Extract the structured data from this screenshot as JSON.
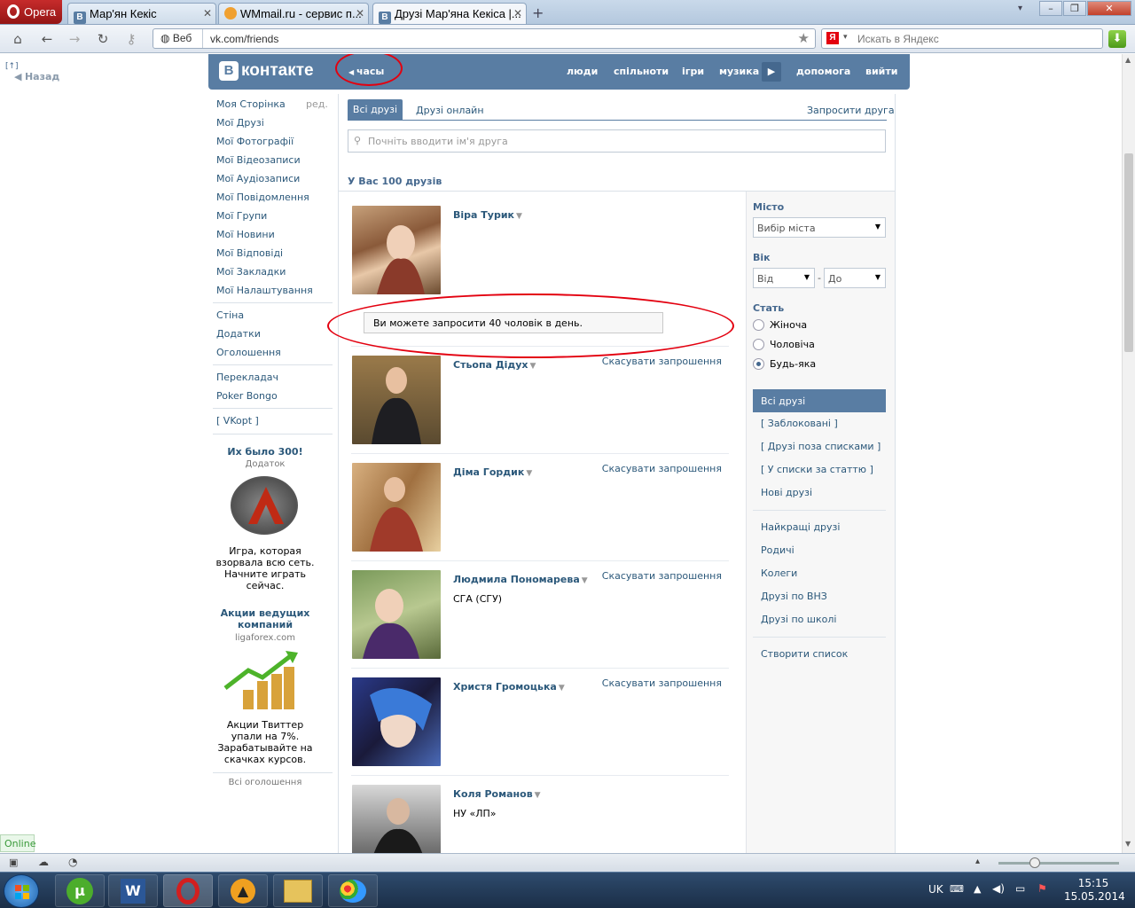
{
  "browser": {
    "opera_label": "Opera",
    "tabs": [
      {
        "title": "Мар'ян Кекіс",
        "fav": "В"
      },
      {
        "title": "WMmail.ru - сервис п...",
        "fav": ""
      },
      {
        "title": "Друзі Мар'яна Кекіса |...",
        "fav": "В"
      }
    ],
    "web_badge": "Веб",
    "url": "vk.com/friends",
    "search_placeholder": "Искать в Яндекс"
  },
  "page": {
    "back_label": "Назад"
  },
  "header": {
    "logo": "контакте",
    "logo_badge": "В",
    "clock_label": "часы",
    "nav": [
      "люди",
      "спільноти",
      "ігри",
      "музика",
      "допомога",
      "вийти"
    ]
  },
  "left_menu": {
    "edit_label": "ред.",
    "items": [
      "Моя Сторінка",
      "Мої Друзі",
      "Мої Фотографії",
      "Мої Відеозаписи",
      "Мої Аудіозаписи",
      "Мої Повідомлення",
      "Мої Групи",
      "Мої Новини",
      "Мої Відповіді",
      "Мої Закладки",
      "Мої Налаштування"
    ],
    "group2": [
      "Стіна",
      "Додатки",
      "Оголошення"
    ],
    "group3": [
      "Перекладач",
      "Poker Bongo"
    ],
    "vkopt": "[ VKopt ]",
    "ad1": {
      "title": "Их было 300!",
      "sub": "Додаток",
      "text": "Игра, которая взорвала всю сеть. Начните играть сейчас."
    },
    "ad2": {
      "title": "Акции ведущих компаний",
      "sub": "ligaforex.com",
      "text": "Акции Твиттер упали на 7%. Зарабатывайте на скачках курсов."
    },
    "all_ads": "Всі оголошення"
  },
  "main": {
    "tab_all": "Всі друзі",
    "tab_online": "Друзі онлайн",
    "invite": "Запросити друга",
    "search_placeholder": "Почніть вводити ім'я друга",
    "count": "У Вас 100 друзів",
    "tooltip": "Ви можете запросити 40 чоловік в день.",
    "friends": [
      {
        "name": "Віра Турик",
        "sub": "",
        "cancel": ""
      },
      {
        "name": "Стьопа Дідух",
        "sub": "",
        "cancel": "Скасувати запрошення"
      },
      {
        "name": "Діма Гордик",
        "sub": "",
        "cancel": "Скасувати запрошення"
      },
      {
        "name": "Людмила Пономарева",
        "sub": "СГА (СГУ)",
        "cancel": "Скасувати запрошення"
      },
      {
        "name": "Христя Громоцька",
        "sub": "",
        "cancel": "Скасувати запрошення"
      },
      {
        "name": "Коля Романов",
        "sub": "НУ «ЛП»",
        "cancel": ""
      }
    ]
  },
  "filter": {
    "city_label": "Місто",
    "city_value": "Вибір міста",
    "age_label": "Вік",
    "age_from": "Від",
    "age_to": "До",
    "gender_label": "Стать",
    "genders": [
      "Жіноча",
      "Чоловіча",
      "Будь-яка"
    ],
    "selected_gender": "Будь-яка",
    "lists_active": "Всі друзі",
    "lists": [
      "[ Заблоковані ]",
      "[ Друзі поза списками ]",
      "[ У списки за статтю ]",
      "Нові друзі"
    ],
    "lists2": [
      "Найкращі друзі",
      "Родичі",
      "Колеги",
      "Друзі по ВНЗ",
      "Друзі по школі"
    ],
    "create": "Створити список"
  },
  "status": {
    "online": "Online"
  },
  "taskbar": {
    "lang": "UK",
    "time": "15:15",
    "date": "15.05.2014"
  },
  "colors": {
    "vk_blue": "#597da3",
    "link": "#2b587a",
    "annotation": "#e3000f"
  }
}
